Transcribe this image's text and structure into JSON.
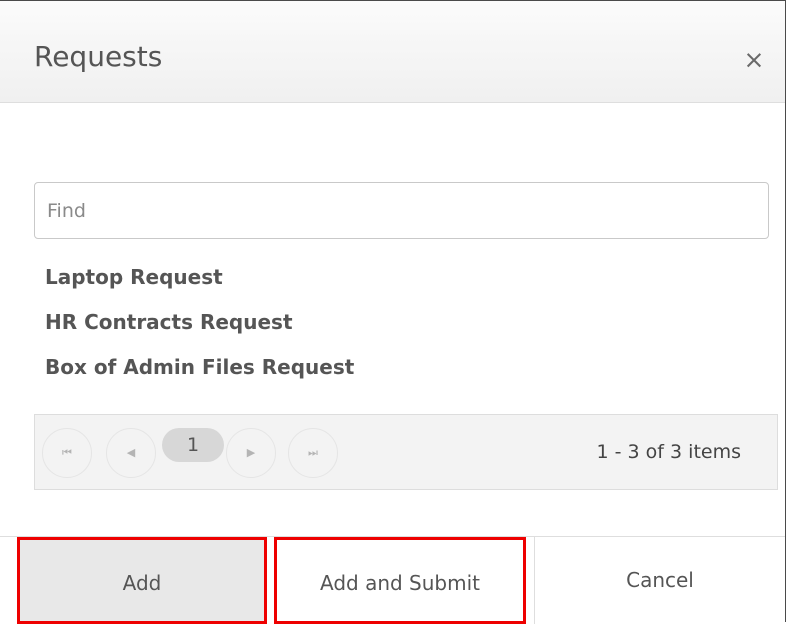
{
  "dialog": {
    "title": "Requests",
    "close_label": "×"
  },
  "search": {
    "placeholder": "Find",
    "value": ""
  },
  "requests": {
    "items": [
      "Laptop Request",
      "HR Contracts Request",
      "Box of Admin Files Request"
    ]
  },
  "pager": {
    "first_icon": "first-page-icon",
    "prev_icon": "previous-page-icon",
    "next_icon": "next-page-icon",
    "last_icon": "last-page-icon",
    "first_glyph": "⏮",
    "prev_glyph": "◀",
    "next_glyph": "▶",
    "last_glyph": "⏭",
    "current_page": "1",
    "info": "1 - 3 of 3 items"
  },
  "footer": {
    "add_label": "Add",
    "add_submit_label": "Add and Submit",
    "cancel_label": "Cancel",
    "highlight_color": "#ee0000"
  }
}
